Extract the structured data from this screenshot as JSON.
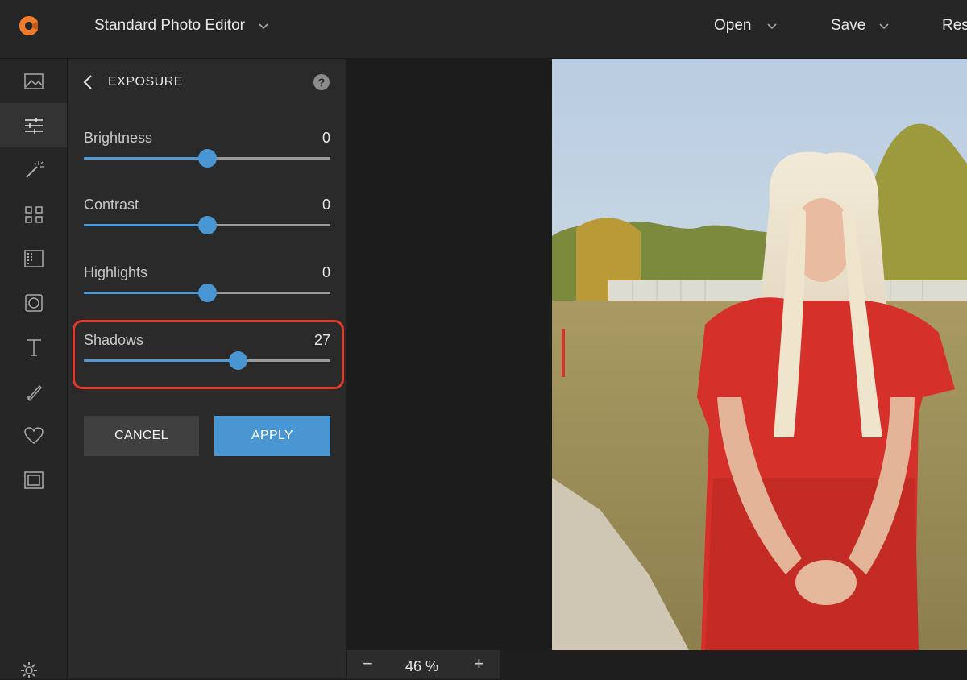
{
  "app": {
    "title": "Standard Photo Editor",
    "accent_color": "#4a96d2",
    "logo_color": "#f07b2a"
  },
  "header": {
    "menus": [
      {
        "label": "Open"
      },
      {
        "label": "Save"
      },
      {
        "label": "Res"
      }
    ]
  },
  "rail": {
    "items": [
      {
        "icon": "image-icon"
      },
      {
        "icon": "sliders-icon",
        "active": true
      },
      {
        "icon": "magic-wand-icon"
      },
      {
        "icon": "grid-icon"
      },
      {
        "icon": "texture-icon"
      },
      {
        "icon": "frame-circle-icon"
      },
      {
        "icon": "text-icon"
      },
      {
        "icon": "brush-icon"
      },
      {
        "icon": "heart-icon"
      },
      {
        "icon": "border-frame-icon"
      }
    ]
  },
  "panel": {
    "title": "EXPOSURE",
    "help": "?",
    "sliders": [
      {
        "label": "Brightness",
        "value": "0",
        "position": 0.5
      },
      {
        "label": "Contrast",
        "value": "0",
        "position": 0.5
      },
      {
        "label": "Highlights",
        "value": "0",
        "position": 0.5
      },
      {
        "label": "Shadows",
        "value": "27",
        "position": 0.625
      }
    ],
    "cancel_label": "CANCEL",
    "apply_label": "APPLY"
  },
  "zoom": {
    "minus": "−",
    "value": "46 %",
    "plus": "+"
  }
}
